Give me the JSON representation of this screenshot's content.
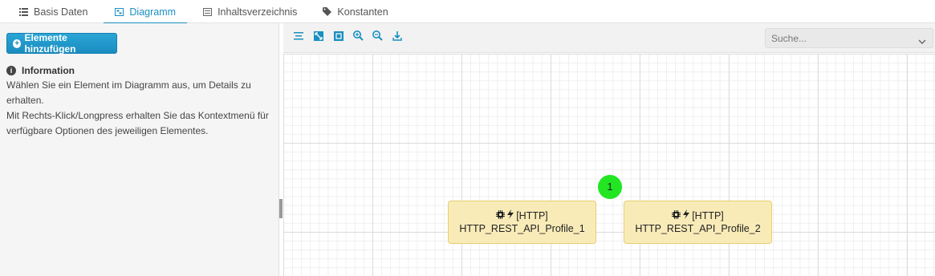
{
  "tabs": [
    {
      "label": "Basis Daten",
      "icon": "list-icon"
    },
    {
      "label": "Diagramm",
      "icon": "diagram-icon",
      "active": true
    },
    {
      "label": "Inhaltsverzeichnis",
      "icon": "index-icon"
    },
    {
      "label": "Konstanten",
      "icon": "tag-icon"
    }
  ],
  "left": {
    "add_button": "Elemente hinzufügen",
    "info_title": "Information",
    "info_lines": [
      "Wählen Sie ein Element im Diagramm aus, um Details zu erhalten.",
      "Mit Rechts-Klick/Longpress erhalten Sie das Kontextmenü für",
      "verfügbare Optionen des jeweiligen Elementes."
    ]
  },
  "toolbar": {
    "buttons": [
      "align-icon",
      "fit-icon",
      "fit-selection-icon",
      "zoom-in-icon",
      "zoom-out-icon",
      "download-icon"
    ],
    "search_placeholder": "Suche..."
  },
  "diagram": {
    "nodes": [
      {
        "type": "[HTTP]",
        "name": "HTTP_REST_API_Profile_1"
      },
      {
        "type": "[HTTP]",
        "name": "HTTP_REST_API_Profile_2"
      }
    ],
    "badge": "1"
  },
  "colors": {
    "accent": "#1a8fc0",
    "node_fill": "#f9ebb8",
    "node_border": "#e8cf6e",
    "badge": "#22e622"
  }
}
